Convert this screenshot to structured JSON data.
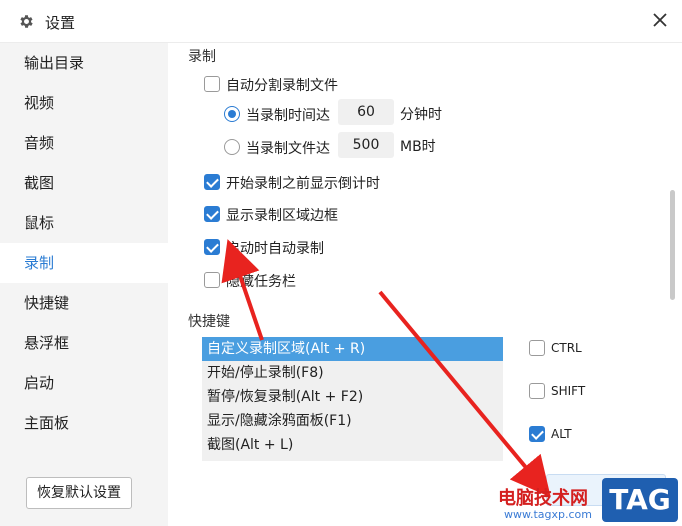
{
  "window": {
    "title": "设置",
    "title_icon": "gear-icon",
    "close_icon": "close-icon"
  },
  "sidebar": {
    "items": [
      {
        "label": "输出目录",
        "active": false
      },
      {
        "label": "视频",
        "active": false
      },
      {
        "label": "音频",
        "active": false
      },
      {
        "label": "截图",
        "active": false
      },
      {
        "label": "鼠标",
        "active": false
      },
      {
        "label": "录制",
        "active": true
      },
      {
        "label": "快捷键",
        "active": false
      },
      {
        "label": "悬浮框",
        "active": false
      },
      {
        "label": "启动",
        "active": false
      },
      {
        "label": "主面板",
        "active": false
      }
    ],
    "restore_label": "恢复默认设置"
  },
  "recording": {
    "title": "录制",
    "auto_split": {
      "label": "自动分割录制文件",
      "checked": false
    },
    "by_time": {
      "label": "当录制时间达",
      "value": "60",
      "unit": "分钟时",
      "selected": true
    },
    "by_size": {
      "label": "当录制文件达",
      "value": "500",
      "unit": "MB时",
      "selected": false
    },
    "countdown": {
      "label": "开始录制之前显示倒计时",
      "checked": true
    },
    "show_border": {
      "label": "显示录制区域边框",
      "checked": true
    },
    "auto_record": {
      "label": "启动时自动录制",
      "checked": true
    },
    "hide_taskbar": {
      "label": "隐藏任务栏",
      "checked": false
    }
  },
  "shortcuts": {
    "title": "快捷键",
    "items": [
      "自定义录制区域(Alt + R)",
      "开始/停止录制(F8)",
      "暂停/恢复录制(Alt + F2)",
      "显示/隐藏涂鸦面板(F1)",
      "截图(Alt + L)"
    ],
    "selected_index": 0,
    "modifiers": [
      {
        "label": "CTRL",
        "checked": false
      },
      {
        "label": "SHIFT",
        "checked": false
      },
      {
        "label": "ALT",
        "checked": true
      }
    ]
  },
  "watermark": {
    "text": "电脑技术网",
    "url": "www.tagxp.com",
    "badge": "TAG"
  },
  "colors": {
    "accent": "#2b7cd3",
    "selection": "#4a9ee0",
    "arrow": "#e8231f",
    "sidebar_bg": "#f4f4f4"
  }
}
